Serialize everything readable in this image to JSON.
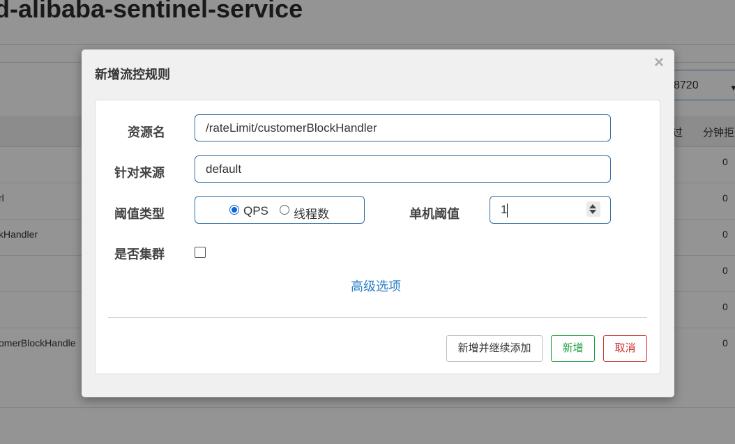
{
  "background": {
    "page_title": "d-alibaba-sentinel-service",
    "machine_select_value": "8720",
    "table_headers": [
      "过",
      "分钟拒"
    ],
    "rows": [
      {
        "name": "",
        "value": "0"
      },
      {
        "name": "rl",
        "value": "0"
      },
      {
        "name": "kHandler",
        "value": "0"
      },
      {
        "name": "",
        "value": "0"
      },
      {
        "name": "",
        "value": "0"
      },
      {
        "name": "omerBlockHandle",
        "value": "0"
      }
    ]
  },
  "modal": {
    "title": "新增流控规则",
    "close_symbol": "×",
    "resource_label": "资源名",
    "resource_value": "/rateLimit/customerBlockHandler",
    "origin_label": "针对来源",
    "origin_value": "default",
    "threshold_type_label": "阈值类型",
    "threshold_type_options": [
      {
        "label": "QPS",
        "checked": true
      },
      {
        "label": "线程数",
        "checked": false
      }
    ],
    "threshold_label": "单机阈值",
    "threshold_value": "1",
    "cluster_label": "是否集群",
    "cluster_checked": false,
    "advanced_link": "高级选项",
    "buttons": {
      "add_continue": "新增并继续添加",
      "add": "新增",
      "cancel": "取消"
    }
  },
  "colors": {
    "input_border": "#2e6da4",
    "link": "#2e7fc6",
    "success": "#1e9e3e",
    "danger": "#c9302c"
  }
}
